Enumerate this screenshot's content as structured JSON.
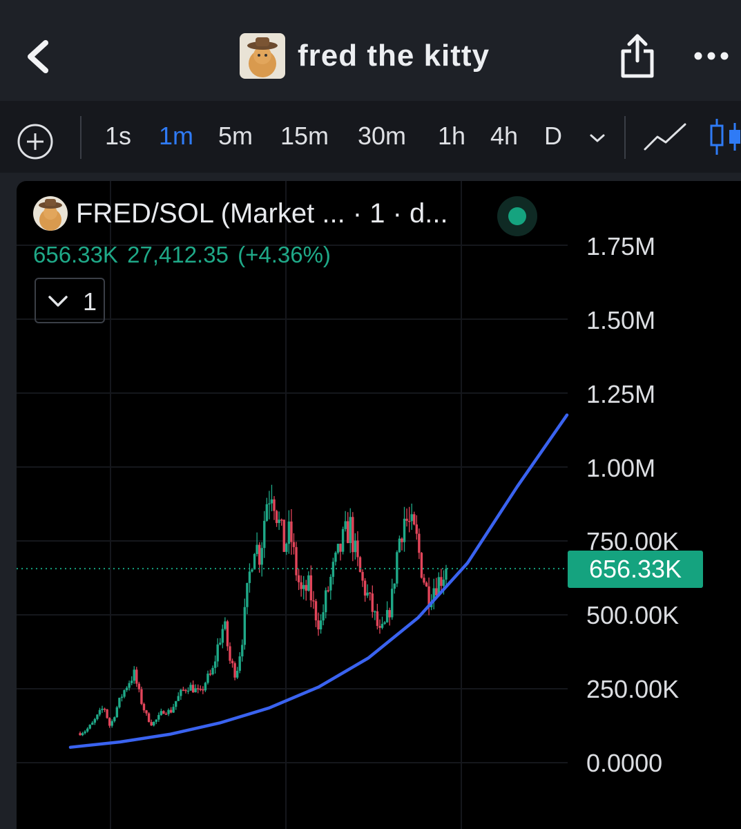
{
  "header": {
    "title": "fred the kitty",
    "back_icon": "chevron-left-icon",
    "share_icon": "share-icon",
    "more_icon": "more-horizontal-icon"
  },
  "toolbar": {
    "timeframes": [
      "1s",
      "1m",
      "5m",
      "15m",
      "30m",
      "1h",
      "4h",
      "D"
    ],
    "active_timeframe": "1m",
    "accent": "#2f7bf6"
  },
  "chart_header": {
    "symbol": "FRED/SOL (Market ... · 1 · d...",
    "last_value": "656.33K",
    "change": "27,412.35 (+4.36%)",
    "collapse_count": "1",
    "status_color": "#15a37f"
  },
  "current_price_label": "656.33K",
  "colors": {
    "up": "#1fa988",
    "down": "#e2455a",
    "trendline": "#3a63f0"
  },
  "chart_data": {
    "type": "candlestick",
    "y_ticks": [
      "0.0000",
      "250.00K",
      "500.00K",
      "750.00K",
      "1.00M",
      "1.25M",
      "1.50M",
      "1.75M"
    ],
    "ylim": [
      0,
      1750000
    ],
    "current_price": 656330,
    "close_path": [
      100000,
      110000,
      130000,
      160000,
      190000,
      120000,
      180000,
      230000,
      270000,
      300000,
      220000,
      160000,
      130000,
      150000,
      180000,
      170000,
      210000,
      240000,
      260000,
      250000,
      230000,
      280000,
      300000,
      400000,
      470000,
      340000,
      300000,
      420000,
      600000,
      750000,
      700000,
      880000,
      940000,
      820000,
      730000,
      780000,
      650000,
      560000,
      600000,
      520000,
      460000,
      560000,
      640000,
      700000,
      760000,
      800000,
      690000,
      610000,
      560000,
      500000,
      430000,
      470000,
      560000,
      740000,
      830000,
      800000,
      760000,
      650000,
      560000,
      600000,
      620000,
      656330
    ],
    "trendline": [
      [
        0,
        52000
      ],
      [
        0.1,
        70000
      ],
      [
        0.2,
        96000
      ],
      [
        0.3,
        134000
      ],
      [
        0.4,
        185000
      ],
      [
        0.5,
        256000
      ],
      [
        0.6,
        354000
      ],
      [
        0.7,
        490000
      ],
      [
        0.8,
        676000
      ],
      [
        0.9,
        934000
      ],
      [
        1.0,
        1176000
      ]
    ]
  }
}
